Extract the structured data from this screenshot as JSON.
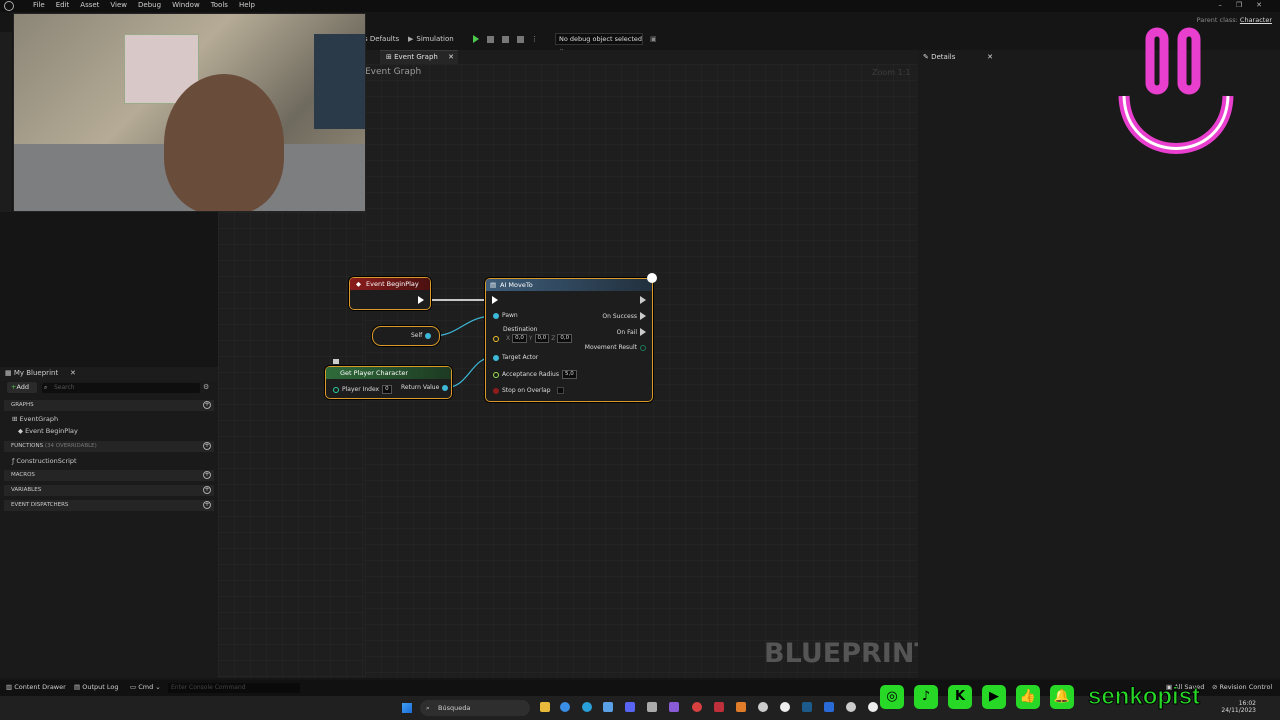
{
  "menubar": {
    "items": [
      "File",
      "Edit",
      "Asset",
      "View",
      "Debug",
      "Window",
      "Tools",
      "Help"
    ],
    "window_controls": [
      "–",
      "❐",
      "✕"
    ]
  },
  "parent_class": {
    "label": "Parent class:",
    "value": "Character"
  },
  "toolbar": {
    "class_defaults": "s Defaults",
    "simulation": "Simulation",
    "debug_object": "No debug object selected ⌄"
  },
  "tabs": {
    "event_graph": "Event Graph",
    "details": "Details"
  },
  "graph": {
    "breadcrumb": "Event Graph",
    "zoom": "Zoom 1:1",
    "watermark": "BLUEPRINT"
  },
  "nodes": {
    "begin_play": {
      "title": "Event BeginPlay"
    },
    "self": {
      "label": "Self"
    },
    "get_player_character": {
      "title": "Get Player Character",
      "player_index_label": "Player Index",
      "player_index_value": "0",
      "return_label": "Return Value"
    },
    "ai_move_to": {
      "title": "AI MoveTo",
      "pawn": "Pawn",
      "destination": "Destination",
      "dest_x": "0,0",
      "dest_y": "0,0",
      "dest_z": "0,0",
      "target_actor": "Target Actor",
      "acceptance_radius": "Acceptance Radius",
      "acceptance_value": "5,0",
      "stop_on_overlap": "Stop on Overlap",
      "on_success": "On Success",
      "on_fail": "On Fail",
      "movement_result": "Movement Result"
    }
  },
  "my_blueprint": {
    "title": "My Blueprint",
    "add": "Add",
    "search_placeholder": "Search",
    "sections": {
      "graphs": "GRAPHS",
      "functions": "FUNCTIONS",
      "functions_count": "(34 OVERRIDABLE)",
      "macros": "MACROS",
      "variables": "VARIABLES",
      "event_dispatchers": "EVENT DISPATCHERS"
    },
    "items": {
      "event_graph": "EventGraph",
      "event_begin_play": "Event BeginPlay",
      "construction_script": "ConstructionScript"
    }
  },
  "statusbar": {
    "content_drawer": "Content Drawer",
    "output_log": "Output Log",
    "cmd": "Cmd ⌄",
    "console_placeholder": "Enter Console Command",
    "all_saved": "All Saved",
    "revision_control": "Revision Control"
  },
  "taskbar": {
    "search": "Búsqueda",
    "time": "16:02",
    "date": "24/11/2023"
  },
  "overlay": {
    "social_handle": "senkopist",
    "social_icons": [
      "instagram-icon",
      "tiktok-icon",
      "kick-icon",
      "youtube-icon",
      "like-icon",
      "bell-icon"
    ],
    "smiley_color": "#e83fcf",
    "accent_green": "#27d827"
  }
}
